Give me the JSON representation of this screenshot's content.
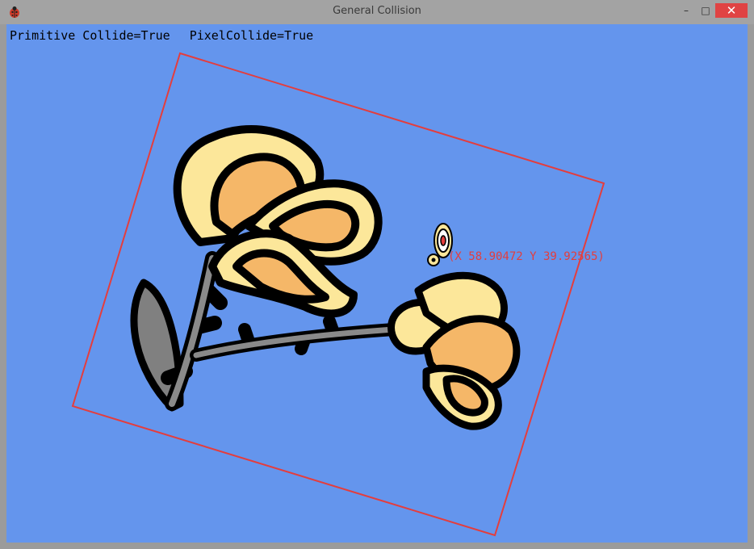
{
  "window": {
    "title": "General Collision",
    "icons": {
      "app": "ladybug-icon",
      "minimize": "minimize-icon",
      "maximize": "maximize-icon",
      "close": "close-icon"
    }
  },
  "status": {
    "primitive_collide": "Primitive Collide=True",
    "pixel_collide": "PixelCollide=True"
  },
  "cursor": {
    "readout": "(X 58.90472  Y 39.92565)"
  },
  "colors": {
    "background": "#6495ed",
    "bounding_box": "#e43d3d",
    "petal_light": "#fce79a",
    "petal_dark": "#f5b768",
    "stem": "#8a8a8a",
    "outline": "#000000"
  }
}
